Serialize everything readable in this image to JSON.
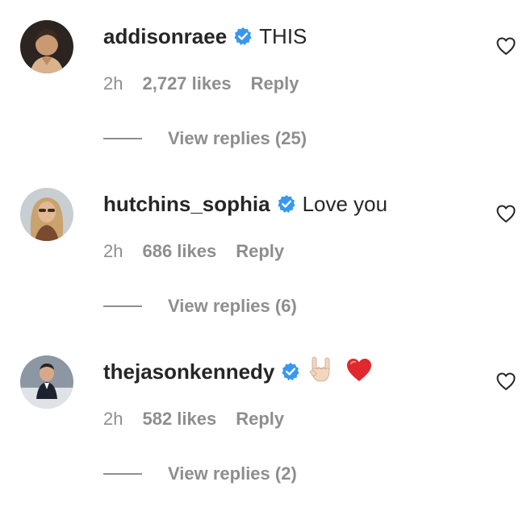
{
  "colors": {
    "text_primary": "#262626",
    "text_secondary": "#8e8e8e",
    "verified_blue": "#3897f0",
    "heart_red": "#e0282e"
  },
  "comments": [
    {
      "username": "addisonraee",
      "verified": true,
      "text": "THIS",
      "time": "2h",
      "likes": "2,727 likes",
      "reply_label": "Reply",
      "view_replies": "View replies (25)",
      "like_icon": "heart-outline-icon"
    },
    {
      "username": "hutchins_sophia",
      "verified": true,
      "text": "Love you",
      "time": "2h",
      "likes": "686 likes",
      "reply_label": "Reply",
      "view_replies": "View replies (6)",
      "like_icon": "heart-outline-icon"
    },
    {
      "username": "thejasonkennedy",
      "verified": true,
      "text": "🤘🏻❤️",
      "emojis": [
        "sign-of-horns-emoji",
        "red-heart-emoji"
      ],
      "time": "2h",
      "likes": "582 likes",
      "reply_label": "Reply",
      "view_replies": "View replies (2)",
      "like_icon": "heart-outline-icon"
    }
  ]
}
